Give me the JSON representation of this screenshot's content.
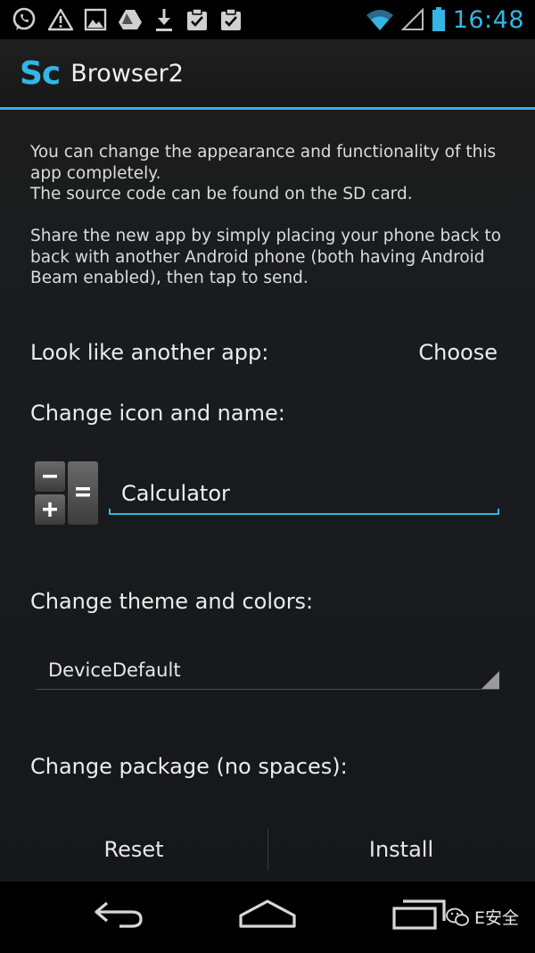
{
  "status_bar": {
    "time": "16:48",
    "notification_icons": [
      "whatsapp-icon",
      "warning-icon",
      "image-icon",
      "drive-icon",
      "download-icon",
      "clipboard-check-icon",
      "clipboard-check-icon"
    ],
    "system_icons": [
      "wifi-icon",
      "signal-icon",
      "battery-icon"
    ]
  },
  "action_bar": {
    "logo": "Sc",
    "title": "Browser2"
  },
  "description": {
    "p1_line1": "You can change the appearance and functionality of this app completely.",
    "p1_line2": "The source code can be found on the SD card.",
    "p2": "Share the new app by simply placing your phone back to back with another Android phone (both having Android Beam enabled), then tap to send."
  },
  "look_like": {
    "label": "Look like another app:",
    "button": "Choose"
  },
  "change_icon": {
    "label": "Change icon and name:",
    "name_value": "Calculator"
  },
  "theme": {
    "label": "Change theme and colors:",
    "selected": "DeviceDefault"
  },
  "package": {
    "label": "Change package (no spaces):"
  },
  "buttons": {
    "reset": "Reset",
    "install": "Install"
  },
  "watermark": {
    "text": "E安全"
  },
  "colors": {
    "accent": "#33b5e5",
    "background": "#1a1c1f",
    "text": "#e6e6e6"
  }
}
